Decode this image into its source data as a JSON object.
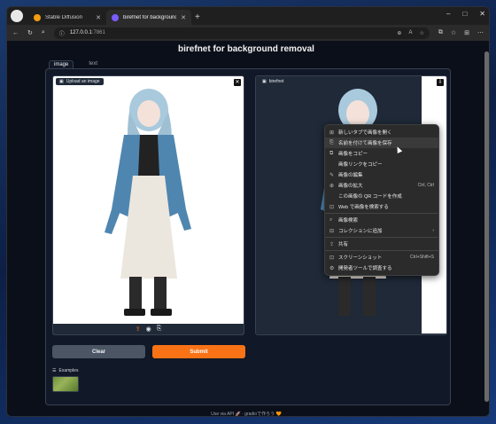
{
  "browser": {
    "tabs": [
      {
        "title": "Stable Diffusion",
        "active": false
      },
      {
        "title": "birefnet for background removal",
        "active": true
      }
    ],
    "window_controls": [
      "–",
      "□",
      "✕"
    ],
    "url_host": "127.0.0.1",
    "url_port": ":7861",
    "url_tools": [
      "⊕",
      "A",
      "☆"
    ]
  },
  "page": {
    "title": "birefnet for background removal",
    "tabs": [
      "image",
      "text"
    ],
    "input_label": "Upload an image",
    "output_label": "birefnet",
    "clear_button": "Clear",
    "submit_button": "Submit",
    "examples_label": "Examples",
    "footer": "Use via API  🚀  ·  gradioで作ろう 🧡"
  },
  "context_menu": {
    "items": [
      {
        "icon": "⊞",
        "label": "新しいタブで画像を開く",
        "shortcut": "",
        "hover": false
      },
      {
        "icon": "⎘",
        "label": "名前を付けて画像を保存",
        "shortcut": "",
        "hover": true
      },
      {
        "icon": "⧉",
        "label": "画像をコピー",
        "shortcut": "",
        "hover": false
      },
      {
        "icon": "",
        "label": "画像リンクをコピー",
        "shortcut": "",
        "hover": false
      },
      {
        "icon": "✎",
        "label": "画像の編集",
        "shortcut": "",
        "hover": false
      },
      {
        "icon": "⊕",
        "label": "画像の拡大",
        "shortcut": "Ctrl, Ctrl",
        "hover": false
      },
      {
        "icon": "",
        "label": "この画像の QR コードを作成",
        "shortcut": "",
        "hover": false
      },
      {
        "icon": "⊡",
        "label": "Web で画像を検索する",
        "shortcut": "",
        "hover": false
      },
      {
        "sep": true
      },
      {
        "icon": "⌕",
        "label": "画像検索",
        "shortcut": "",
        "hover": false
      },
      {
        "icon": "⊟",
        "label": "コレクションに追加",
        "shortcut": "›",
        "hover": false
      },
      {
        "sep": true
      },
      {
        "icon": "⇪",
        "label": "共有",
        "shortcut": "",
        "hover": false
      },
      {
        "sep": true
      },
      {
        "icon": "⊡",
        "label": "スクリーンショット",
        "shortcut": "Ctrl+Shift+S",
        "hover": false
      },
      {
        "icon": "⚙",
        "label": "開発者ツールで調査する",
        "shortcut": "",
        "hover": false
      }
    ]
  },
  "colors": {
    "accent": "#f97316",
    "panel": "#111827",
    "background": "#0b0f19"
  }
}
